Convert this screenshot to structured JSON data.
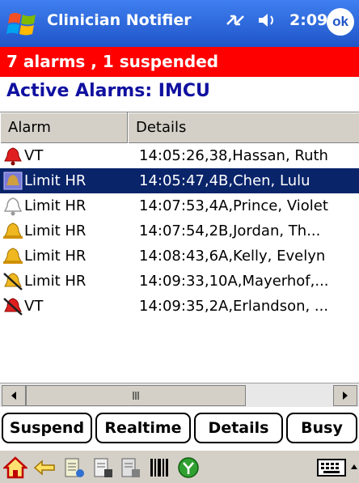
{
  "titlebar": {
    "app_title": "Clinician Notifier",
    "time": "2:09",
    "ok_label": "ok"
  },
  "status": {
    "summary": "7 alarms , 1 suspended"
  },
  "page": {
    "heading": "Active Alarms: IMCU"
  },
  "listview": {
    "columns": [
      "Alarm",
      "Details"
    ],
    "rows": [
      {
        "alarm": "VT",
        "details": "14:05:26,38,Hassan, Ruth",
        "icon": "bell-red-icon"
      },
      {
        "alarm": "Limit HR",
        "details": "14:05:47,4B,Chen, Lulu",
        "icon": "bell-suspended-icon",
        "selected": true
      },
      {
        "alarm": "Limit HR",
        "details": "14:07:53,4A,Prince, Violet",
        "icon": "bell-outline-icon"
      },
      {
        "alarm": "Limit HR",
        "details": "14:07:54,2B,Jordan, Th...",
        "icon": "bell-yellow-icon"
      },
      {
        "alarm": "Limit HR",
        "details": "14:08:43,6A,Kelly, Evelyn",
        "icon": "bell-yellow-icon"
      },
      {
        "alarm": "Limit HR",
        "details": "14:09:33,10A,Mayerhof,...",
        "icon": "bell-yellow-muted-icon"
      },
      {
        "alarm": "VT",
        "details": "14:09:35,2A,Erlandson, ...",
        "icon": "bell-red-muted-icon"
      }
    ]
  },
  "buttons": {
    "suspend": "Suspend",
    "realtime": "Realtime",
    "details": "Details",
    "busy": "Busy"
  },
  "colors": {
    "titlebar": "#1f55c8",
    "alarm_bar": "#ff0000",
    "heading": "#1010a0",
    "selection": "#0a246a"
  }
}
